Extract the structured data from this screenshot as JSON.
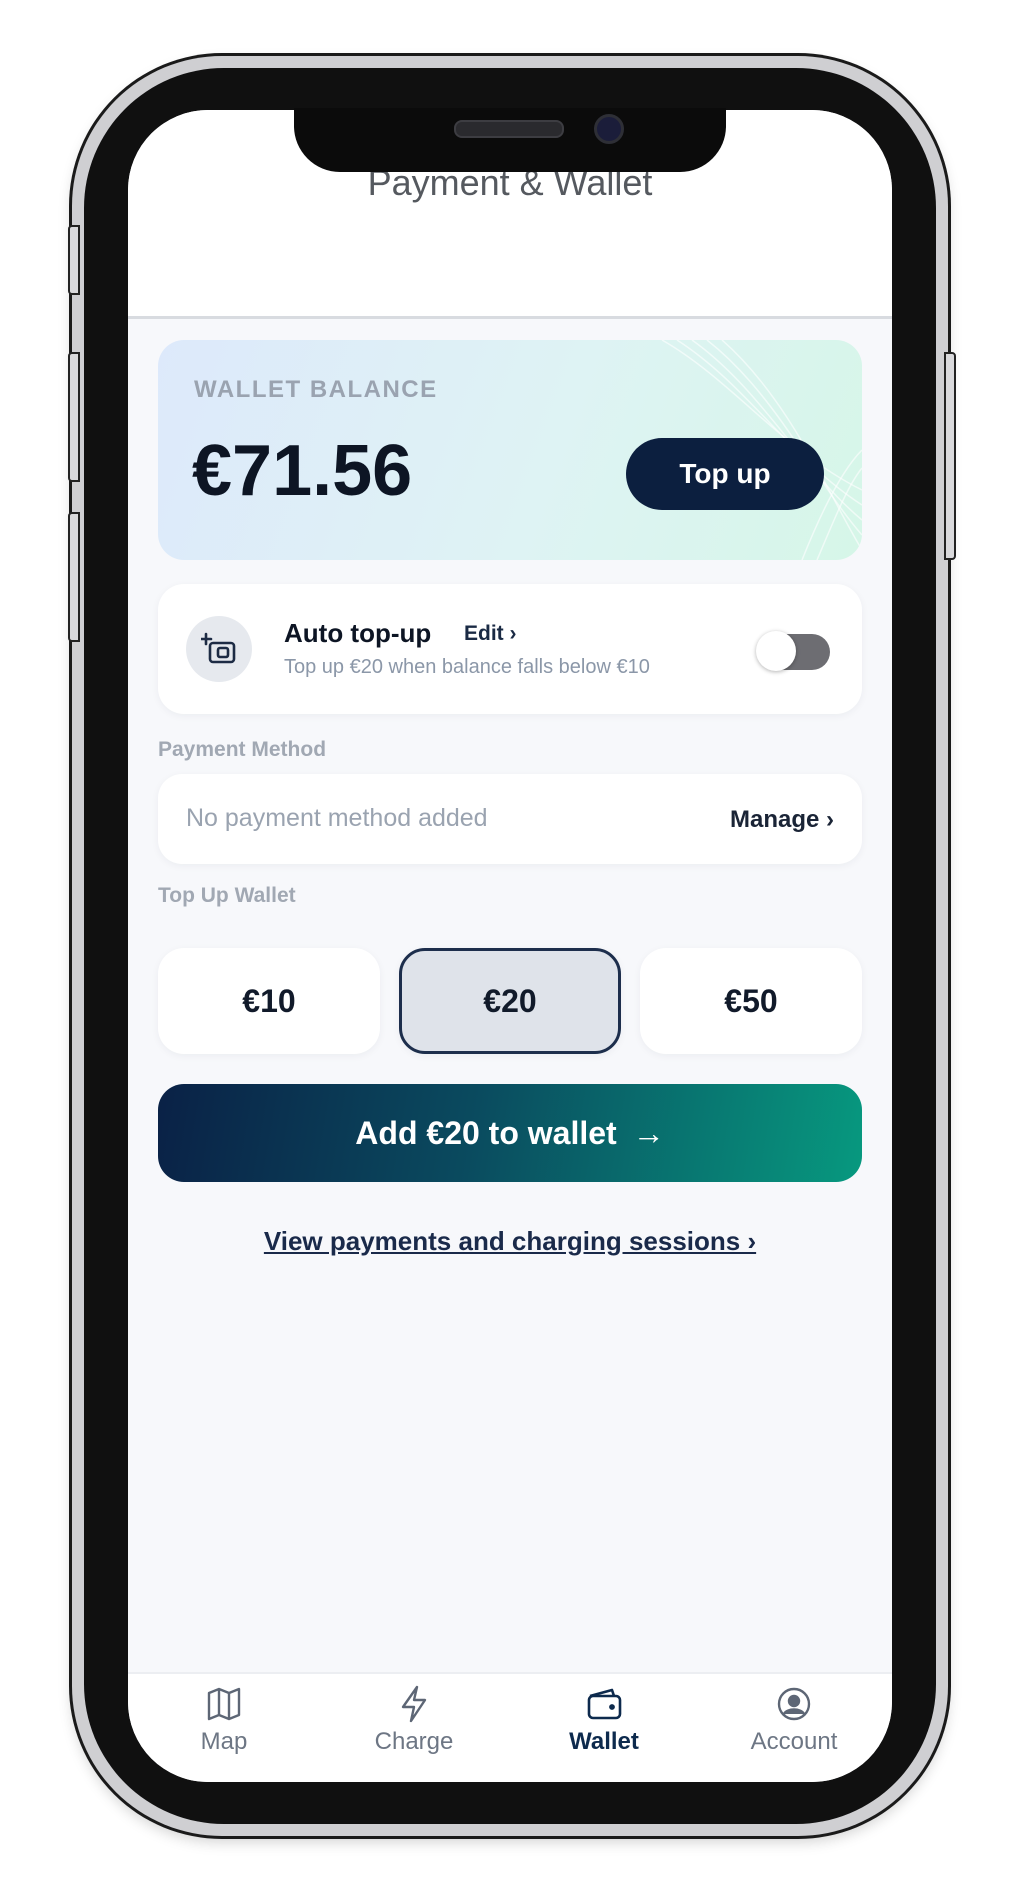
{
  "header": {
    "title": "Payment & Wallet"
  },
  "wallet": {
    "label": "WALLET BALANCE",
    "balance": "€71.56",
    "top_up_label": "Top up"
  },
  "auto_topup": {
    "title": "Auto top-up",
    "edit_label": "Edit ›",
    "description": "Top up €20 when balance falls below €10",
    "enabled": false
  },
  "payment_method": {
    "section_label": "Payment Method",
    "empty_text": "No payment method added",
    "manage_label": "Manage ›"
  },
  "top_up_wallet": {
    "section_label": "Top Up Wallet",
    "amounts": [
      "€10",
      "€20",
      "€50"
    ],
    "selected": "€20",
    "add_button_label": "Add €20 to wallet",
    "add_button_arrow": "→"
  },
  "history_link": "View payments and charging sessions ›",
  "nav": {
    "items": [
      {
        "label": "Map",
        "icon": "map-icon"
      },
      {
        "label": "Charge",
        "icon": "lightning-icon"
      },
      {
        "label": "Wallet",
        "icon": "wallet-icon",
        "active": true
      },
      {
        "label": "Account",
        "icon": "account-icon"
      }
    ]
  },
  "colors": {
    "primary_dark": "#0c1f3f",
    "accent_teal": "#07997f",
    "background": "#f7f8fb"
  }
}
